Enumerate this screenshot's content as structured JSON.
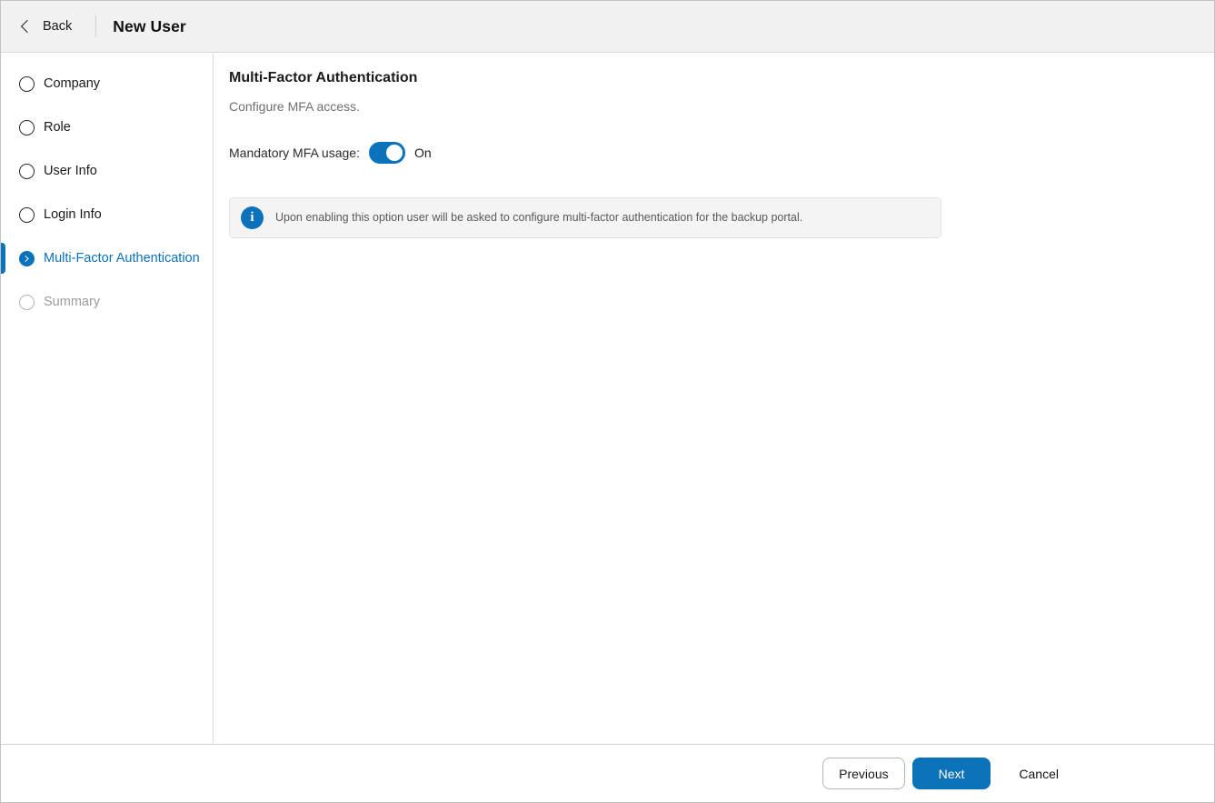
{
  "header": {
    "back_label": "Back",
    "title": "New User"
  },
  "sidebar": {
    "items": [
      {
        "label": "Company",
        "state": "pending"
      },
      {
        "label": "Role",
        "state": "pending"
      },
      {
        "label": "User Info",
        "state": "pending"
      },
      {
        "label": "Login Info",
        "state": "pending"
      },
      {
        "label": "Multi-Factor Authentication",
        "state": "active"
      },
      {
        "label": "Summary",
        "state": "disabled"
      }
    ]
  },
  "main": {
    "title": "Multi-Factor Authentication",
    "subtitle": "Configure MFA access.",
    "mfa_toggle": {
      "label": "Mandatory MFA usage:",
      "state_label": "On",
      "enabled": true
    },
    "info_banner": {
      "icon": "info-icon",
      "text": "Upon enabling this option user will be asked to configure multi-factor authentication for the backup portal."
    }
  },
  "footer": {
    "previous_label": "Previous",
    "next_label": "Next",
    "cancel_label": "Cancel"
  },
  "colors": {
    "accent_blue": "#0c72ba",
    "header_bg": "#f1f1f1",
    "border": "#d9d9d9",
    "banner_bg": "#f4f4f5",
    "disabled_text": "#9c9c9c"
  }
}
